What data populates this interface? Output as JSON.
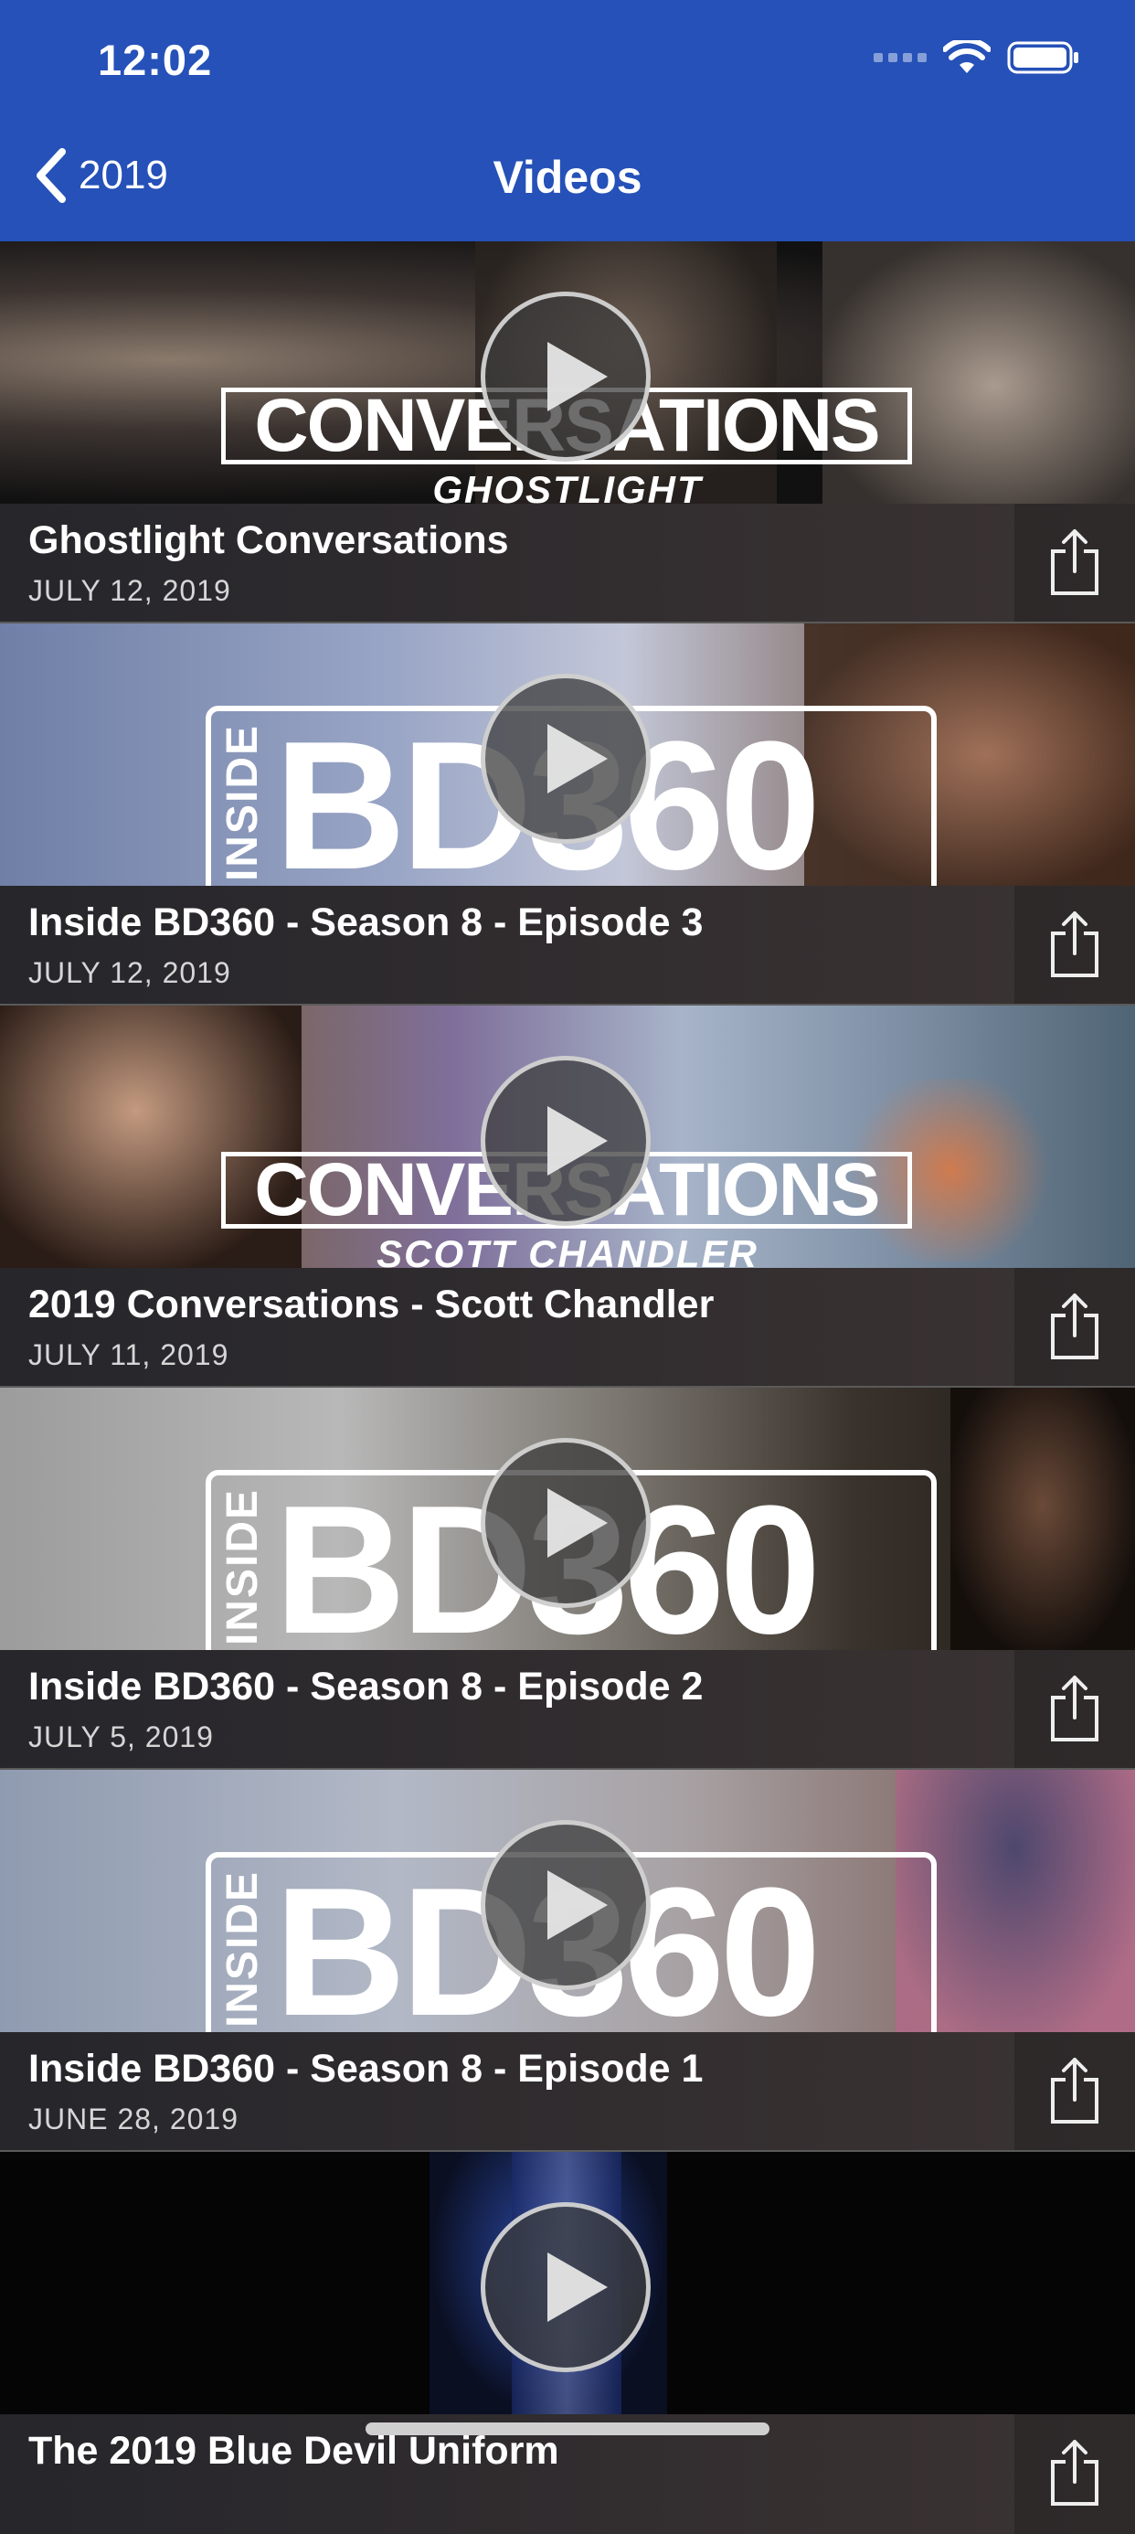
{
  "status": {
    "time": "12:02"
  },
  "nav": {
    "back_label": "2019",
    "title": "Videos"
  },
  "colors": {
    "nav_bar": "#2551b8"
  },
  "videos": [
    {
      "title": "Ghostlight Conversations",
      "date": "JULY 12, 2019",
      "thumb_type": "conversations",
      "thumb_main": "CONVERSATIONS",
      "thumb_sub": "GHOSTLIGHT"
    },
    {
      "title": "Inside BD360 - Season 8 - Episode 3",
      "date": "JULY 12, 2019",
      "thumb_type": "bd360",
      "thumb_main": "BD360",
      "thumb_sub": "INSIDE"
    },
    {
      "title": "2019 Conversations - Scott Chandler",
      "date": "JULY 11, 2019",
      "thumb_type": "conversations",
      "thumb_main": "CONVERSATIONS",
      "thumb_sub": "SCOTT CHANDLER"
    },
    {
      "title": "Inside BD360 - Season 8 - Episode 2",
      "date": "JULY 5, 2019",
      "thumb_type": "bd360",
      "thumb_main": "BD360",
      "thumb_sub": "INSIDE"
    },
    {
      "title": "Inside BD360 - Season 8 - Episode 1",
      "date": "JUNE 28, 2019",
      "thumb_type": "bd360",
      "thumb_main": "BD360",
      "thumb_sub": "INSIDE"
    },
    {
      "title": "The 2019 Blue Devil Uniform",
      "date": "",
      "thumb_type": "plain",
      "thumb_main": "",
      "thumb_sub": ""
    }
  ]
}
